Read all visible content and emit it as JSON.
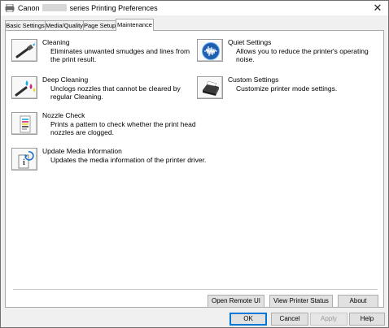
{
  "window": {
    "title_prefix": "Canon",
    "title_suffix": "series Printing Preferences",
    "close_glyph": "✕"
  },
  "tabs": [
    {
      "label": "Basic Settings"
    },
    {
      "label": "Media/Quality"
    },
    {
      "label": "Page Setup"
    },
    {
      "label": "Maintenance",
      "active": true
    }
  ],
  "features": {
    "cleaning": {
      "title": "Cleaning",
      "desc": "Eliminates unwanted smudges and lines from the print result.",
      "icon": "brush-icon"
    },
    "deep_cleaning": {
      "title": "Deep Cleaning",
      "desc": "Unclogs nozzles that cannot be cleared by regular Cleaning.",
      "icon": "brush-drops-icon"
    },
    "nozzle_check": {
      "title": "Nozzle Check",
      "desc": "Prints a pattern to check whether the print head nozzles are clogged.",
      "icon": "nozzle-pattern-icon"
    },
    "update_media": {
      "title": "Update Media Information",
      "desc": "Updates the media information of the printer driver.",
      "icon": "document-refresh-icon"
    },
    "quiet_settings": {
      "title": "Quiet Settings",
      "desc": "Allows you to reduce the printer's operating noise.",
      "icon": "sound-wave-icon"
    },
    "custom_settings": {
      "title": "Custom Settings",
      "desc": "Customize printer mode settings.",
      "icon": "printer-icon"
    }
  },
  "panel_buttons": {
    "open_remote_ui": "Open Remote UI",
    "view_printer_status": "View Printer Status",
    "about": "About"
  },
  "dialog_buttons": {
    "ok": "OK",
    "cancel": "Cancel",
    "apply": "Apply",
    "help": "Help"
  },
  "colors": {
    "accent_blue": "#0078d7",
    "cyan": "#1fa9e1",
    "magenta": "#d4237a",
    "yellow": "#f2d21b"
  }
}
